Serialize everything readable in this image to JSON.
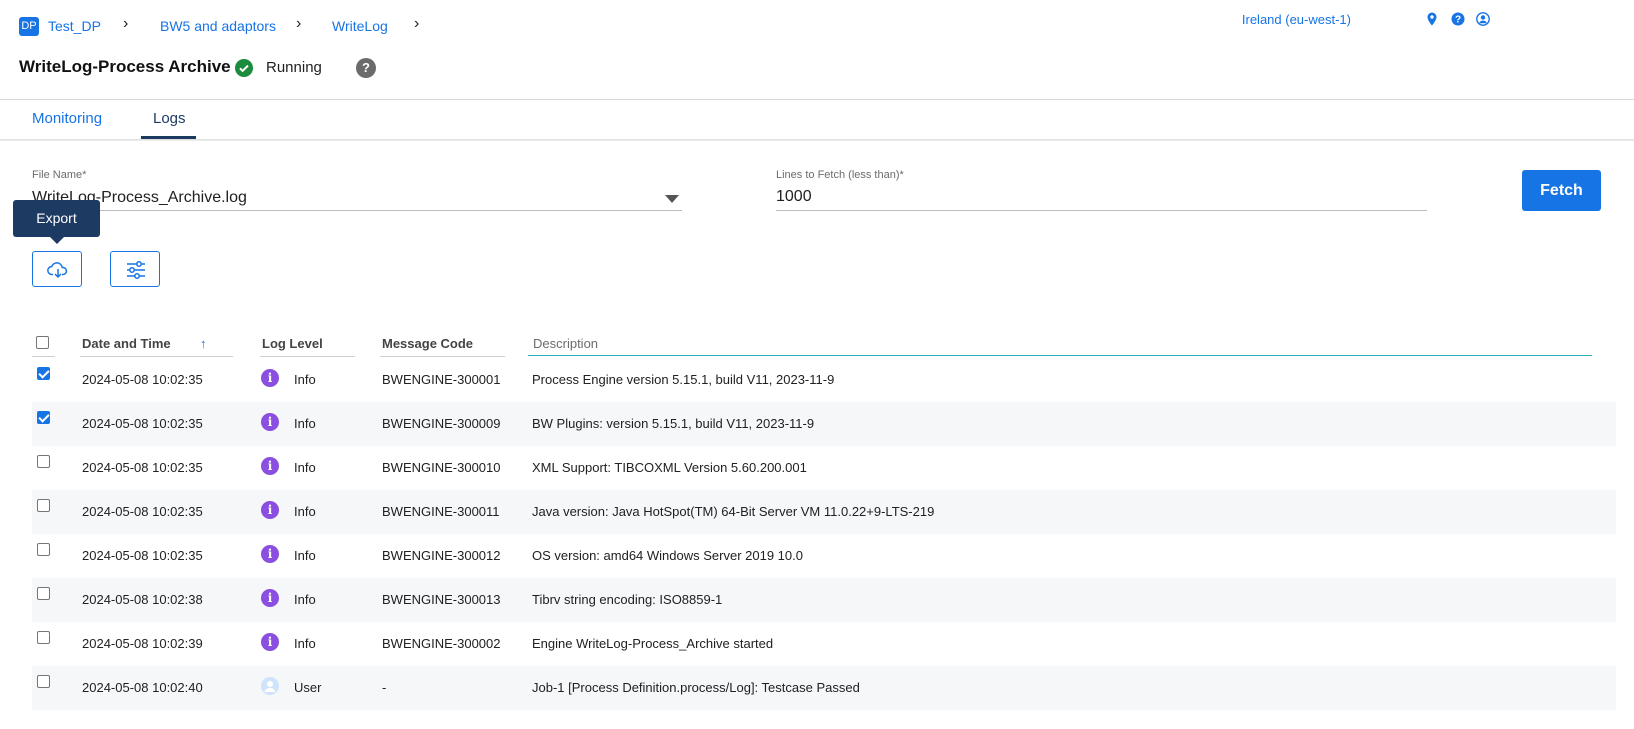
{
  "breadcrumb": {
    "logo": "DP",
    "items": [
      "Test_DP",
      "BW5 and adaptors",
      "WriteLog"
    ]
  },
  "region": "Ireland (eu-west-1)",
  "header": {
    "title": "WriteLog-Process Archive",
    "status": "Running",
    "help": "?"
  },
  "tabs": [
    {
      "label": "Monitoring",
      "active": false
    },
    {
      "label": "Logs",
      "active": true
    }
  ],
  "form": {
    "file_name_label": "File Name*",
    "file_name_value": "WriteLog-Process_Archive.log",
    "lines_label": "Lines to Fetch (less than)*",
    "lines_value": "1000",
    "fetch_label": "Fetch"
  },
  "tooltip": "Export",
  "table": {
    "headers": {
      "date": "Date and Time",
      "level": "Log Level",
      "code": "Message Code",
      "description": "Description"
    },
    "rows": [
      {
        "checked": true,
        "date": "2024-05-08 10:02:35",
        "level": "Info",
        "level_icon": "info-icon",
        "code": "BWENGINE-300001",
        "description": "Process Engine version 5.15.1, build V11, 2023-11-9"
      },
      {
        "checked": true,
        "date": "2024-05-08 10:02:35",
        "level": "Info",
        "level_icon": "info-icon",
        "code": "BWENGINE-300009",
        "description": "BW Plugins: version 5.15.1, build V11, 2023-11-9"
      },
      {
        "checked": false,
        "date": "2024-05-08 10:02:35",
        "level": "Info",
        "level_icon": "info-icon",
        "code": "BWENGINE-300010",
        "description": "XML Support: TIBCOXML Version 5.60.200.001"
      },
      {
        "checked": false,
        "date": "2024-05-08 10:02:35",
        "level": "Info",
        "level_icon": "info-icon",
        "code": "BWENGINE-300011",
        "description": "Java version: Java HotSpot(TM) 64-Bit Server VM 11.0.22+9-LTS-219"
      },
      {
        "checked": false,
        "date": "2024-05-08 10:02:35",
        "level": "Info",
        "level_icon": "info-icon",
        "code": "BWENGINE-300012",
        "description": "OS version: amd64 Windows Server 2019 10.0"
      },
      {
        "checked": false,
        "date": "2024-05-08 10:02:38",
        "level": "Info",
        "level_icon": "info-icon",
        "code": "BWENGINE-300013",
        "description": "Tibrv string encoding: ISO8859-1"
      },
      {
        "checked": false,
        "date": "2024-05-08 10:02:39",
        "level": "Info",
        "level_icon": "info-icon",
        "code": "BWENGINE-300002",
        "description": "Engine WriteLog-Process_Archive started"
      },
      {
        "checked": false,
        "date": "2024-05-08 10:02:40",
        "level": "User",
        "level_icon": "user-icon",
        "code": "-",
        "description": "Job-1 [Process Definition.process/Log]: Testcase Passed"
      }
    ]
  },
  "colors": {
    "accent": "#1774e5",
    "navy": "#1d3a63",
    "running": "#1b8c3e",
    "info": "#8a4fe0"
  }
}
